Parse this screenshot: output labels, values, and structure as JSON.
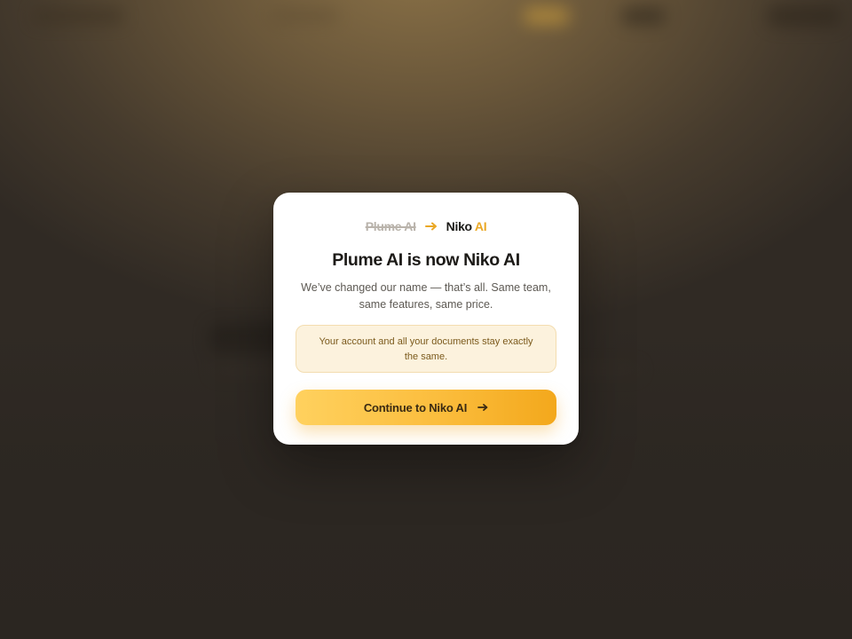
{
  "rebrand": {
    "old_name": "Plume AI",
    "new_name_base": "Niko",
    "new_name_accent": "AI",
    "arrow_icon": "arrow-right-icon"
  },
  "modal": {
    "title": "Plume AI is now Niko AI",
    "subtitle_line1": "We’ve changed our name — that’s all. Same team,",
    "subtitle_line2": "same features, same price.",
    "notice_line1": "Your account and all your documents stay exactly",
    "notice_line2": "the same.",
    "cta_label": "Continue to Niko AI",
    "cta_icon": "arrow-right-icon"
  },
  "colors": {
    "accent": "#eaa825",
    "cta_start": "#ffd15e",
    "cta_end": "#f3a81c",
    "notice_bg": "#fcf2dd",
    "notice_text": "#7b5a1c",
    "backdrop": "#2b2621"
  }
}
